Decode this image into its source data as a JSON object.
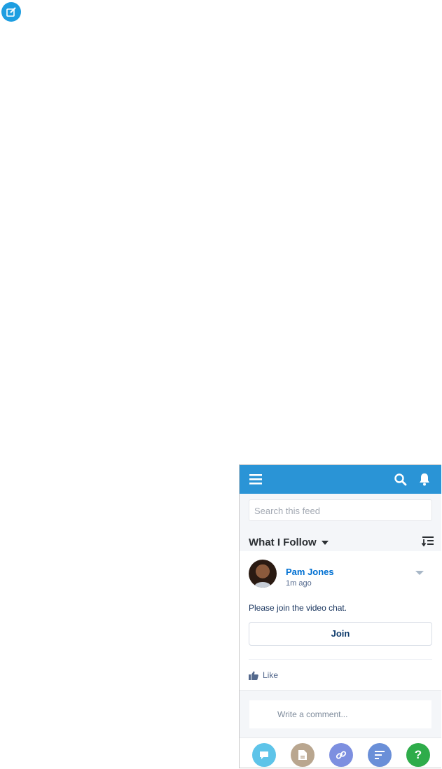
{
  "header": {
    "search_placeholder": "Search this feed"
  },
  "feed_filter": {
    "label": "What I Follow"
  },
  "post": {
    "author": "Pam Jones",
    "time": "1m ago",
    "body": "Please join the video chat.",
    "join_label": "Join",
    "like_label": "Like",
    "comment_placeholder": "Write a comment..."
  },
  "actions": [
    {
      "name": "post-action",
      "icon": "chat-bubble-icon",
      "color": "#5ec4e9"
    },
    {
      "name": "file-action",
      "icon": "file-icon",
      "color": "#b9a68f"
    },
    {
      "name": "link-action",
      "icon": "link-icon",
      "color": "#7d8fe0"
    },
    {
      "name": "poll-action",
      "icon": "poll-icon",
      "color": "#6a8fd8"
    },
    {
      "name": "question-action",
      "icon": "question-icon",
      "color": "#2eac4a"
    }
  ],
  "colors": {
    "brand": "#2a94d6",
    "accent": "#1e9ee1",
    "link": "#0070d2"
  }
}
